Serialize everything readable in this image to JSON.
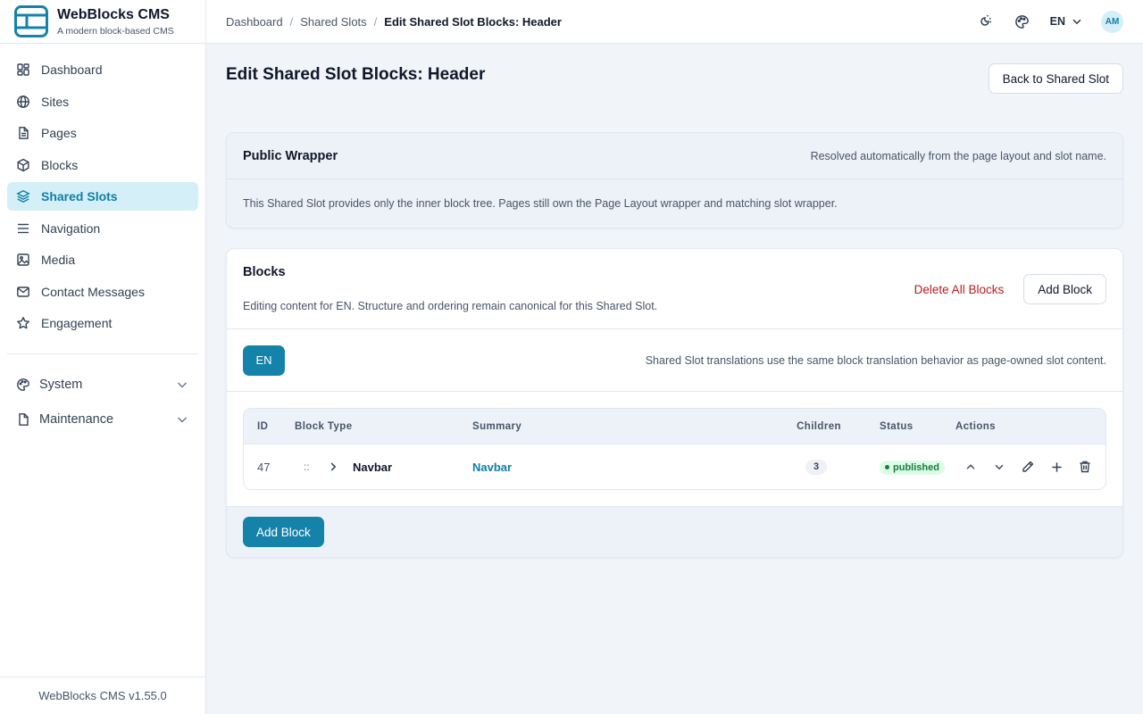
{
  "brand": {
    "title": "WebBlocks CMS",
    "subtitle": "A modern block-based CMS",
    "logo_icon": "layout-logo-icon",
    "accent": "#1583a9"
  },
  "sidebar": {
    "items": [
      {
        "label": "Dashboard",
        "icon": "dashboard-icon"
      },
      {
        "label": "Sites",
        "icon": "globe-icon"
      },
      {
        "label": "Pages",
        "icon": "file-text-icon"
      },
      {
        "label": "Blocks",
        "icon": "cube-icon"
      },
      {
        "label": "Shared Slots",
        "icon": "layers-icon",
        "active": true
      },
      {
        "label": "Navigation",
        "icon": "menu-icon"
      },
      {
        "label": "Media",
        "icon": "image-icon"
      },
      {
        "label": "Contact Messages",
        "icon": "mail-icon"
      },
      {
        "label": "Engagement",
        "icon": "star-icon"
      }
    ],
    "groups": [
      {
        "label": "System",
        "icon": "palette-icon"
      },
      {
        "label": "Maintenance",
        "icon": "file-icon"
      }
    ],
    "footer": "WebBlocks CMS v1.55.0"
  },
  "topbar": {
    "breadcrumbs": [
      "Dashboard",
      "Shared Slots",
      "Edit Shared Slot Blocks: Header"
    ],
    "language": "EN",
    "avatar": "AM"
  },
  "page": {
    "title": "Edit Shared Slot Blocks: Header",
    "back_label": "Back to Shared Slot"
  },
  "wrapper": {
    "title": "Public Wrapper",
    "hint": "Resolved automatically from the page layout and slot name.",
    "body": "This Shared Slot provides only the inner block tree. Pages still own the Page Layout wrapper and matching slot wrapper."
  },
  "blocks": {
    "title": "Blocks",
    "description": "Editing content for EN. Structure and ordering remain canonical for this Shared Slot.",
    "delete_all_label": "Delete All Blocks",
    "add_label": "Add Block",
    "language_tab": "EN",
    "language_note": "Shared Slot translations use the same block translation behavior as page-owned slot content.",
    "columns": [
      "ID",
      "Block Type",
      "Summary",
      "Children",
      "Status",
      "Actions"
    ],
    "rows": [
      {
        "id": "47",
        "drag": "::",
        "type": "Navbar",
        "summary": "Navbar",
        "children": "3",
        "status": "published"
      }
    ],
    "footer_add_label": "Add Block"
  }
}
